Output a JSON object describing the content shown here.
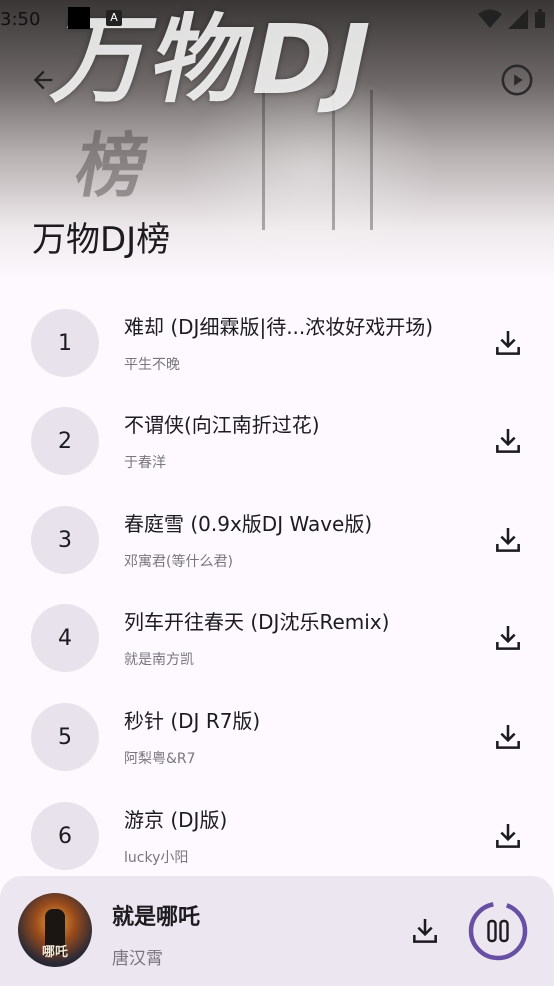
{
  "status": {
    "time": "3:50"
  },
  "header": {
    "artwork_text": "万物DJ",
    "artwork_subtext": "榜",
    "title": "万物DJ榜",
    "back_icon": "arrow-left-icon",
    "play_all_icon": "play-circle-icon"
  },
  "songs": [
    {
      "rank": "1",
      "title": "难却 (DJ细霖版|待...浓妆好戏开场)",
      "artist": "平生不晚"
    },
    {
      "rank": "2",
      "title": "不谓侠(向江南折过花)",
      "artist": "于春洋"
    },
    {
      "rank": "3",
      "title": "春庭雪 (0.9x版DJ Wave版)",
      "artist": "邓寓君(等什么君)"
    },
    {
      "rank": "4",
      "title": "列车开往春天 (DJ沈乐Remix)",
      "artist": "就是南方凯"
    },
    {
      "rank": "5",
      "title": "秒针 (DJ R7版)",
      "artist": "阿梨粤&R7"
    },
    {
      "rank": "6",
      "title": "游京 (DJ版)",
      "artist": "lucky小阳"
    }
  ],
  "now_playing": {
    "title": "就是哪吒",
    "artist": "唐汉霄",
    "art_text": "哪吒",
    "progress": 0.08,
    "state": "playing"
  },
  "colors": {
    "accent": "#6750a4",
    "rank_bg": "#e8e2ec",
    "player_bg": "#ece6f0",
    "page_bg": "#fdf9fe"
  }
}
